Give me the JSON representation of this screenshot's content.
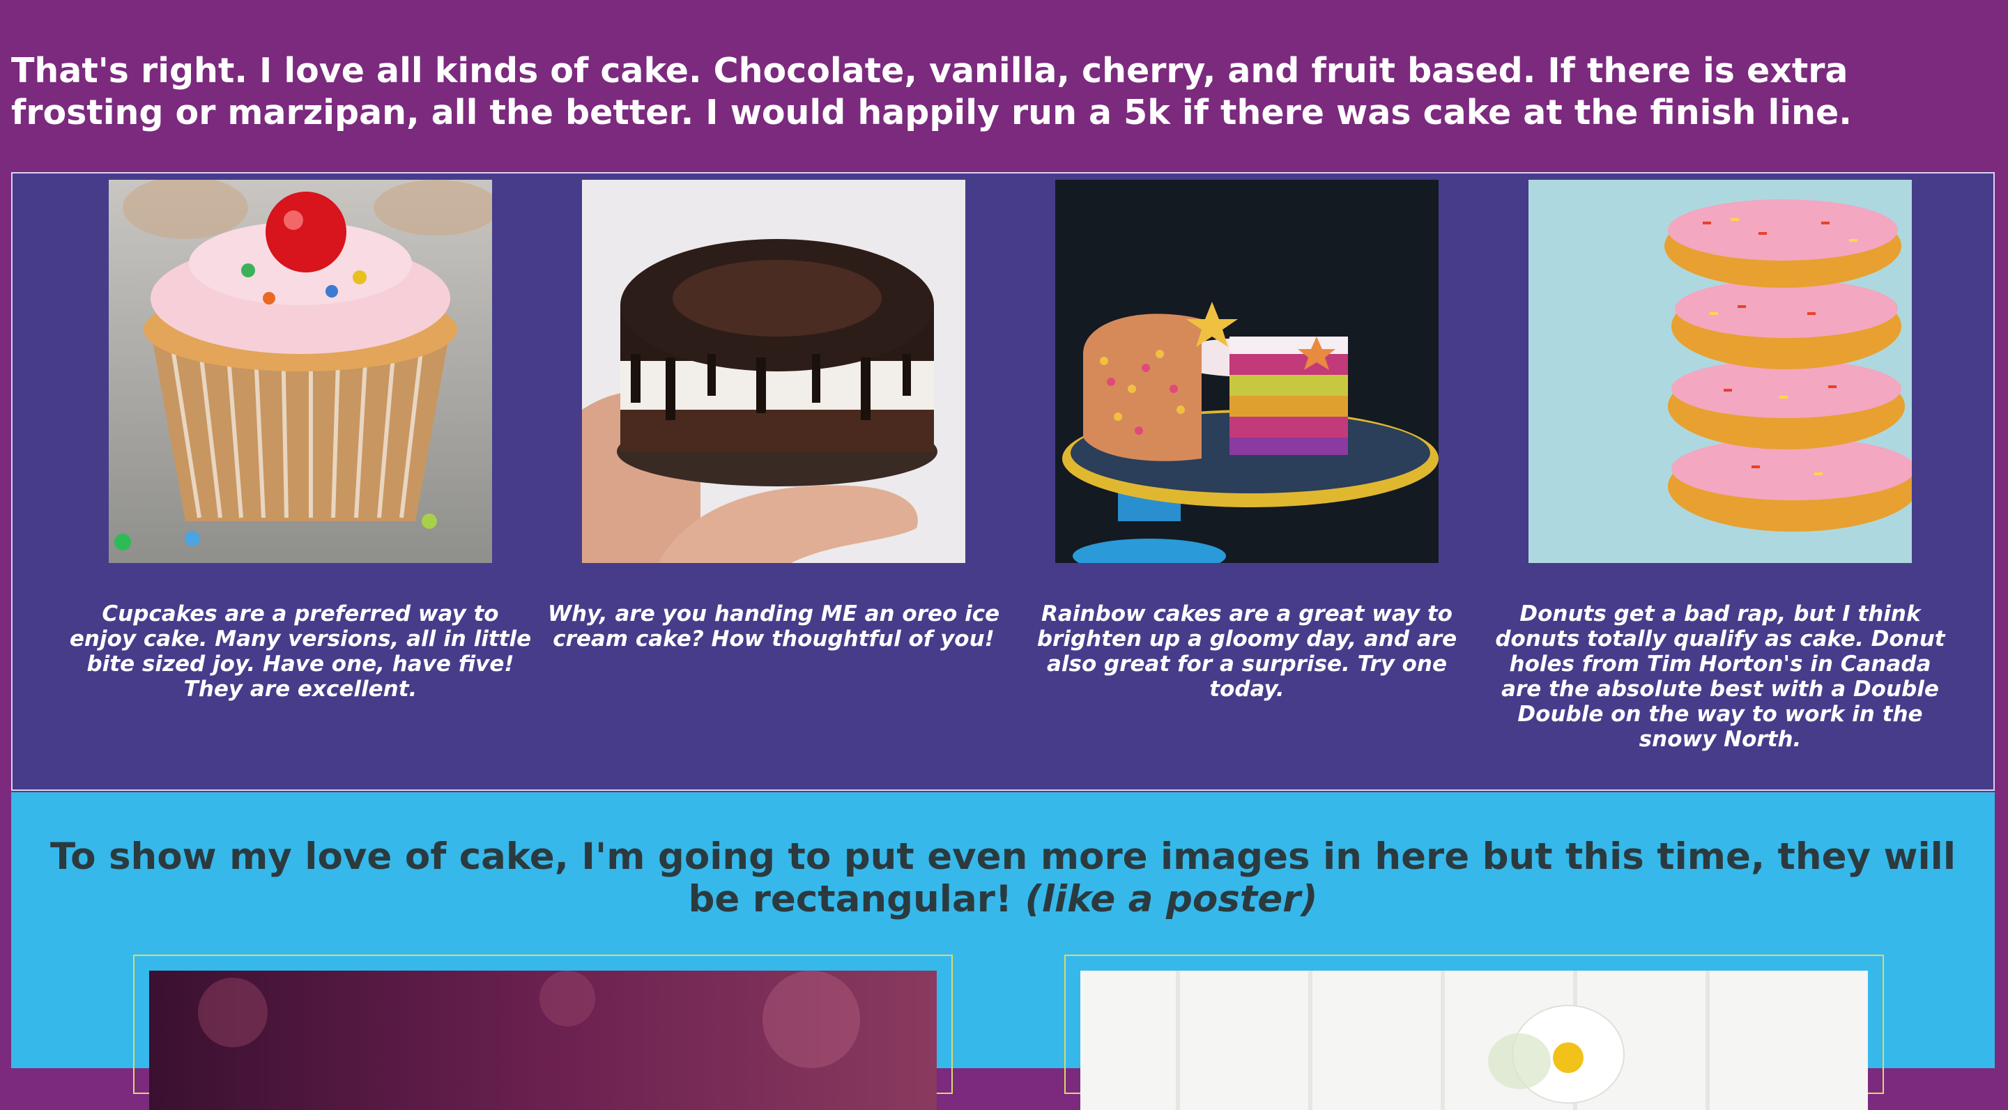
{
  "intro": {
    "text": "That's right. I love all kinds of cake. Chocolate, vanilla, cherry, and fruit based. If there is extra frosting or marzipan, all the better. I would happily run a 5k if there was cake at the finish line."
  },
  "gallery": {
    "items": [
      {
        "image": "cupcake-photo",
        "caption": "Cupcakes are a preferred way to enjoy cake. Many versions, all in little bite sized joy. Have one, have five! They are excellent."
      },
      {
        "image": "oreo-cake-photo",
        "caption": "Why, are you handing ME an oreo ice cream cake? How thoughtful of you!"
      },
      {
        "image": "rainbow-cake-photo",
        "caption": "Rainbow cakes are a great way to brighten up a gloomy day, and are also great for a surprise. Try one today."
      },
      {
        "image": "donuts-photo",
        "caption": "Donuts get a bad rap, but I think donuts totally qualify as cake. Donut holes from Tim Horton's in Canada are the absolute best with a Double Double on the way to work in the snowy North."
      }
    ]
  },
  "posters": {
    "heading_main": "To show my love of cake, I'm going to put even more images in here but this time, they will be rectangular!",
    "heading_emphasis": "(like a poster)",
    "items": [
      {
        "image": "purple-bokeh-poster"
      },
      {
        "image": "white-flower-cake-poster"
      }
    ]
  },
  "colors": {
    "page_bg": "#7b2a7e",
    "gallery_bg": "#463c8a",
    "poster_section_bg": "#36b8ea",
    "heading_text": "#2b3a3f",
    "frame_border": "#dcd96a"
  }
}
